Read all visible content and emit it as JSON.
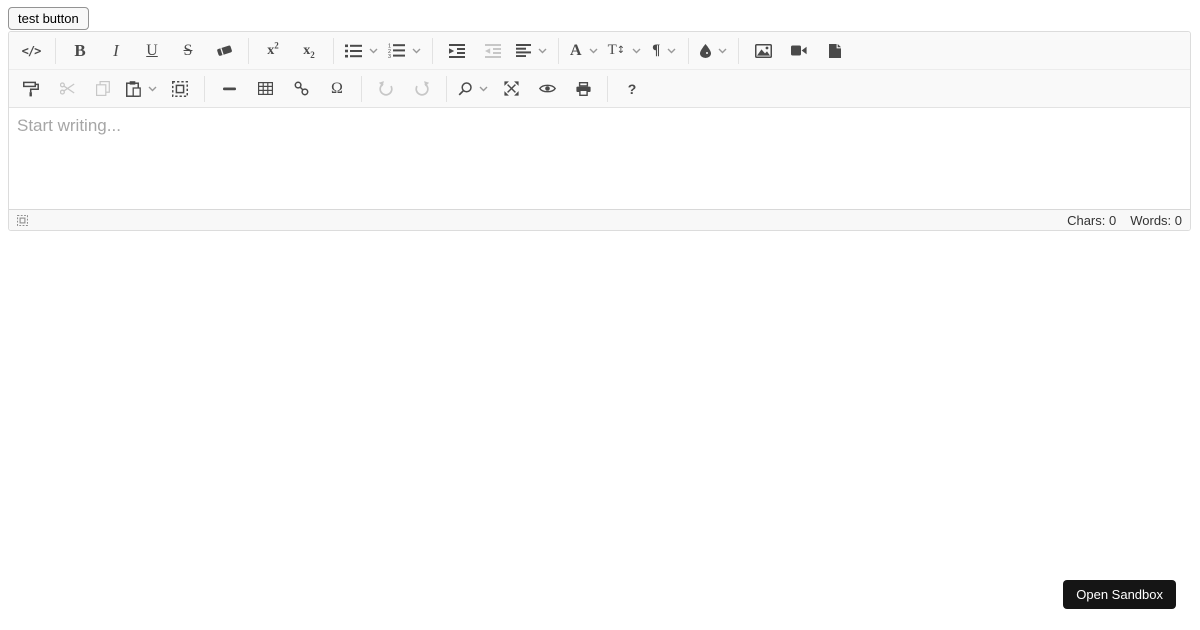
{
  "test_button": {
    "label": "test button"
  },
  "toolbar": {
    "glyphs": {
      "code_view": "</>",
      "bold": "B",
      "italic": "I",
      "underline": "U",
      "strikethrough": "S",
      "sup_base": "x",
      "sup_script": "2",
      "sub_base": "x",
      "sub_script": "2",
      "font_family": "A",
      "font_size_letter": "T",
      "font_size_arrows": "↕",
      "paragraph": "¶",
      "special_characters": "Ω",
      "help": "?"
    },
    "row1_buttons": [
      "code-view",
      "bold",
      "italic",
      "underline",
      "strikethrough",
      "clear-formatting",
      "superscript",
      "subscript",
      "unordered-list",
      "ordered-list",
      "indent",
      "outdent",
      "align",
      "font-family",
      "font-size",
      "paragraph-format",
      "brush-color",
      "insert-image",
      "insert-video",
      "insert-file"
    ],
    "row2_buttons": [
      "format-painter",
      "cut",
      "copy",
      "paste",
      "select-all",
      "horizontal-rule",
      "insert-table",
      "insert-link",
      "special-characters",
      "undo",
      "redo",
      "search",
      "fullscreen",
      "preview",
      "print",
      "help"
    ],
    "disabled_buttons": [
      "cut",
      "copy",
      "outdent",
      "undo",
      "redo"
    ],
    "dropdown_buttons": [
      "unordered-list",
      "ordered-list",
      "align",
      "font-family",
      "font-size",
      "paragraph-format",
      "brush-color",
      "paste",
      "search"
    ]
  },
  "editor": {
    "placeholder": "Start writing..."
  },
  "status_bar": {
    "chars": "Chars: 0",
    "words": "Words: 0"
  },
  "open_sandbox_button": {
    "label": "Open Sandbox"
  },
  "colors": {
    "toolbar_bg": "#f9f9f9",
    "border": "#dcdcdc",
    "icon": "#4a4a4a",
    "icon_disabled": "#c7c7c7",
    "chevron": "#999999",
    "placeholder_text": "#a6a6a6",
    "sandbox_bg": "#151515",
    "sandbox_text": "#ffffff"
  }
}
